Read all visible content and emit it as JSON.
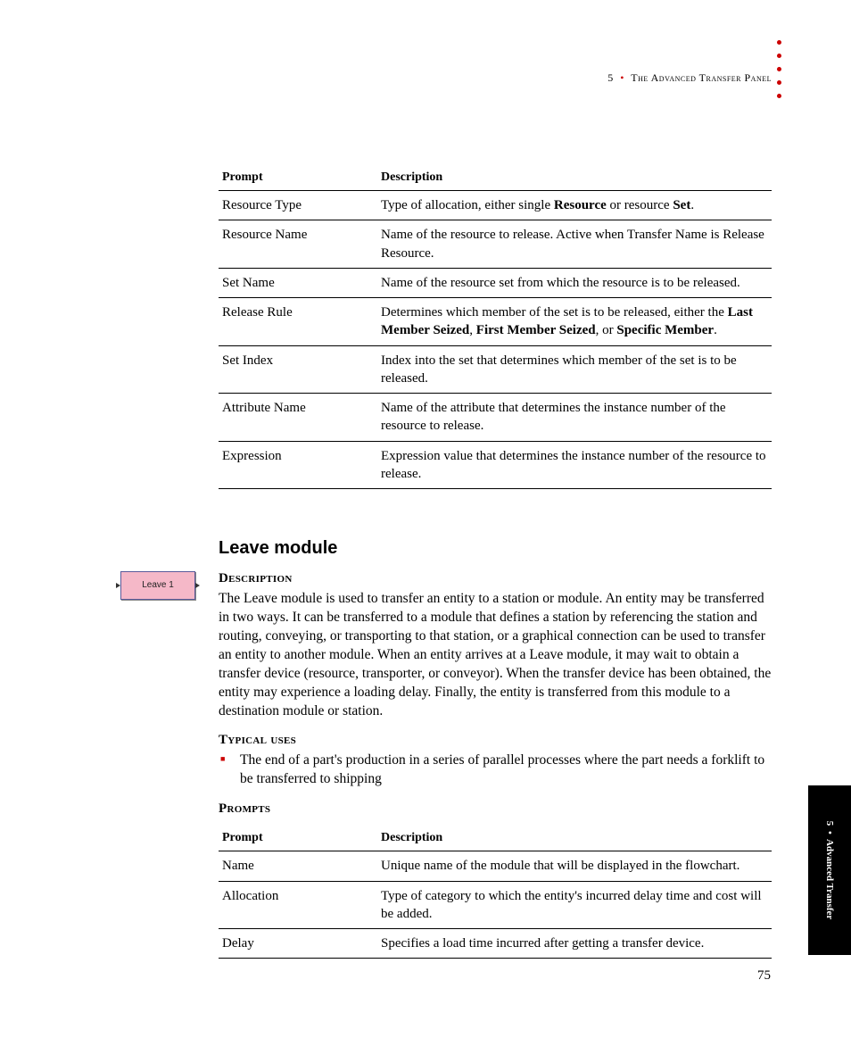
{
  "header": {
    "chapter_num": "5",
    "title": "The Advanced Transfer Panel"
  },
  "table1": {
    "headers": [
      "Prompt",
      "Description"
    ],
    "rows": [
      {
        "prompt": "Resource Type",
        "desc_parts": [
          "Type of allocation, either single ",
          "Resource",
          " or resource ",
          "Set",
          "."
        ],
        "bold_idx": [
          1,
          3
        ]
      },
      {
        "prompt": "Resource Name",
        "desc_parts": [
          "Name of the resource to release. Active when Transfer Name is Release Resource."
        ],
        "bold_idx": []
      },
      {
        "prompt": "Set Name",
        "desc_parts": [
          "Name of the resource set from which the resource is to be released."
        ],
        "bold_idx": []
      },
      {
        "prompt": "Release Rule",
        "desc_parts": [
          "Determines which member of the set is to be released, either the ",
          "Last Member Seized",
          ", ",
          "First Member Seized",
          ", or ",
          "Specific Member",
          "."
        ],
        "bold_idx": [
          1,
          3,
          5
        ]
      },
      {
        "prompt": "Set Index",
        "desc_parts": [
          "Index into the set that determines which member of the set is to be released."
        ],
        "bold_idx": []
      },
      {
        "prompt": "Attribute Name",
        "desc_parts": [
          "Name of the attribute that determines the instance number of the resource to release."
        ],
        "bold_idx": []
      },
      {
        "prompt": "Expression",
        "desc_parts": [
          "Expression value that determines the instance number of the resource to release."
        ],
        "bold_idx": []
      }
    ]
  },
  "section": {
    "title": "Leave module",
    "desc_heading": "Description",
    "description": "The Leave module is used to transfer an entity to a station or module. An entity may be transferred in two ways. It can be transferred to a module that defines a station by referencing the station and routing, conveying, or transporting to that station, or a graphical connection can be used to transfer an entity to another module. When an entity arrives at a Leave module, it may wait to obtain a transfer device (resource, transporter, or conveyor). When the transfer device has been obtained, the entity may experience a loading delay. Finally, the entity is transferred from this module to a destination module or station.",
    "uses_heading": "Typical uses",
    "uses": [
      "The end of a part's production in a series of parallel processes where the part needs a forklift to be transferred to shipping"
    ],
    "prompts_heading": "Prompts"
  },
  "icon": {
    "label": "Leave 1"
  },
  "table2": {
    "headers": [
      "Prompt",
      "Description"
    ],
    "rows": [
      {
        "prompt": "Name",
        "desc_parts": [
          "Unique name of the module that will be displayed in the flowchart."
        ],
        "bold_idx": []
      },
      {
        "prompt": "Allocation",
        "desc_parts": [
          "Type of category to which the entity's incurred delay time and cost will be added."
        ],
        "bold_idx": []
      },
      {
        "prompt": "Delay",
        "desc_parts": [
          "Specifies a load time incurred after getting a transfer device."
        ],
        "bold_idx": []
      }
    ]
  },
  "side_tab": {
    "chapter_num": "5",
    "label": "Advanced Transfer"
  },
  "page_number": "75"
}
